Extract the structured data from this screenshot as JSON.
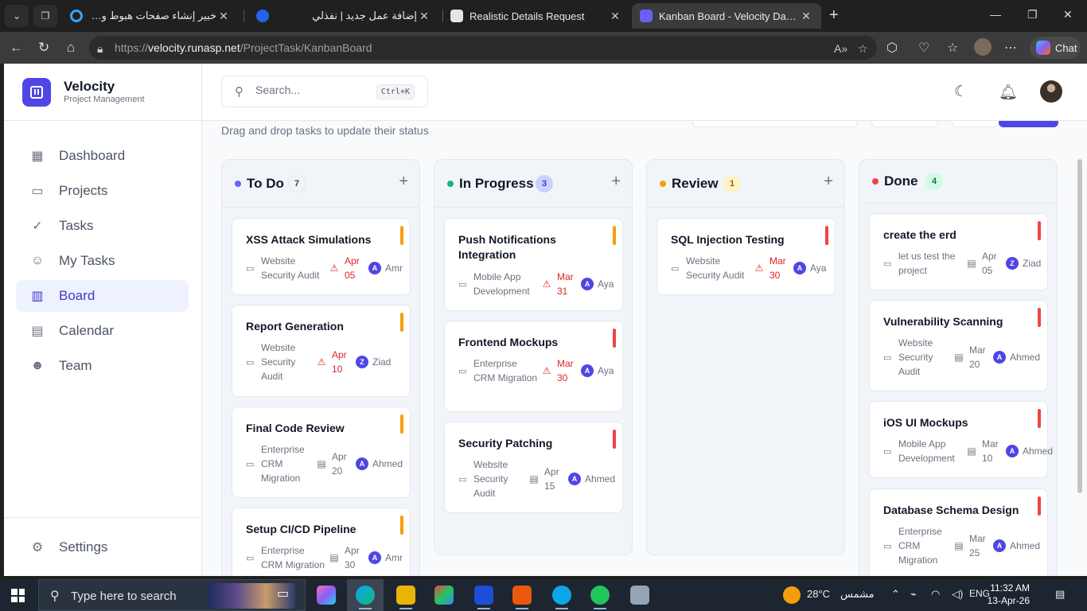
{
  "browser": {
    "tabs": [
      {
        "title": "خبير إنشاء صفحات هبوط ومسارات بي",
        "favicon_color": "#3aa0ff"
      },
      {
        "title": "إضافة عمل جديد | نفذلي",
        "favicon_color": "#2563eb"
      },
      {
        "title": "Realistic Details Request",
        "favicon_color": "#e5e5e5"
      },
      {
        "title": "Kanban Board - Velocity Dashboard",
        "favicon_color": "#6d5ef5"
      }
    ],
    "url_scheme": "https://",
    "url_host": "velocity.runasp.net",
    "url_path": "/ProjectTask/KanbanBoard",
    "chat_label": "Chat"
  },
  "sidebar": {
    "brand_name": "Velocity",
    "brand_sub": "Project Management",
    "items": [
      {
        "label": "Dashboard",
        "icon": "dashboard-icon",
        "glyph": "▦"
      },
      {
        "label": "Projects",
        "icon": "folder-icon",
        "glyph": "▭"
      },
      {
        "label": "Tasks",
        "icon": "check-circle-icon",
        "glyph": "✓"
      },
      {
        "label": "My Tasks",
        "icon": "user-badge-icon",
        "glyph": "☺"
      },
      {
        "label": "Board",
        "icon": "board-icon",
        "glyph": "▥"
      },
      {
        "label": "Calendar",
        "icon": "calendar-icon",
        "glyph": "▤"
      },
      {
        "label": "Team",
        "icon": "team-icon",
        "glyph": "☻"
      }
    ],
    "settings_label": "Settings"
  },
  "topbar": {
    "search_placeholder": "Search...",
    "search_shortcut": "Ctrl+K"
  },
  "board": {
    "subtitle": "Drag and drop tasks to update their status",
    "columns": [
      {
        "title": "To Do",
        "count": "7",
        "dot": "#6366f1",
        "badge_bg": "#f3f4f6",
        "badge_fg": "#374151",
        "cards": [
          {
            "title": "XSS Attack Simulations",
            "project": "Website Security Audit",
            "date": "Apr 05",
            "overdue": true,
            "assignee": "Amr",
            "initial": "A",
            "priority": "#f59e0b"
          },
          {
            "title": "Report Generation",
            "project": "Website Security Audit",
            "date": "Apr 10",
            "overdue": true,
            "assignee": "Ziad",
            "initial": "Z",
            "priority": "#f59e0b"
          },
          {
            "title": "Final Code Review",
            "project": "Enterprise CRM Migration",
            "date": "Apr 20",
            "overdue": false,
            "assignee": "Ahmed",
            "initial": "A",
            "priority": "#f59e0b"
          },
          {
            "title": "Setup CI/CD Pipeline",
            "project": "Enterprise CRM Migration",
            "date": "Apr 30",
            "overdue": false,
            "assignee": "Amr",
            "initial": "A",
            "priority": "#f59e0b"
          }
        ]
      },
      {
        "title": "In Progress",
        "count": "3",
        "dot": "#10b981",
        "badge_bg": "#c7d2fe",
        "badge_fg": "#4338ca",
        "cards": [
          {
            "title": "Push Notifications Integration",
            "project": "Mobile App Development",
            "date": "Mar 31",
            "overdue": true,
            "assignee": "Aya",
            "initial": "A",
            "priority": "#f59e0b"
          },
          {
            "title": "Frontend Mockups",
            "project": "Enterprise CRM Migration",
            "date": "Mar 30",
            "overdue": true,
            "assignee": "Aya",
            "initial": "A",
            "priority": "#ef4444"
          },
          {
            "title": "Security Patching",
            "project": "Website Security Audit",
            "date": "Apr 15",
            "overdue": false,
            "assignee": "Ahmed",
            "initial": "A",
            "priority": "#ef4444"
          }
        ]
      },
      {
        "title": "Review",
        "count": "1",
        "dot": "#f59e0b",
        "badge_bg": "#fef3c7",
        "badge_fg": "#b45309",
        "cards": [
          {
            "title": "SQL Injection Testing",
            "project": "Website Security Audit",
            "date": "Mar 30",
            "overdue": true,
            "assignee": "Aya",
            "initial": "A",
            "priority": "#ef4444"
          }
        ]
      },
      {
        "title": "Done",
        "count": "4",
        "dot": "#ef4444",
        "badge_bg": "#d1fae5",
        "badge_fg": "#047857",
        "cards": [
          {
            "title": "create the erd",
            "project": "let us test the project",
            "date": "Apr 05",
            "overdue": false,
            "assignee": "Ziad",
            "initial": "Z",
            "priority": "#ef4444"
          },
          {
            "title": "Vulnerability Scanning",
            "project": "Website Security Audit",
            "date": "Mar 20",
            "overdue": false,
            "assignee": "Ahmed",
            "initial": "A",
            "priority": "#ef4444"
          },
          {
            "title": "iOS UI Mockups",
            "project": "Mobile App Development",
            "date": "Mar 10",
            "overdue": false,
            "assignee": "Ahmed",
            "initial": "A",
            "priority": "#ef4444"
          },
          {
            "title": "Database Schema Design",
            "project": "Enterprise CRM Migration",
            "date": "Mar 25",
            "overdue": false,
            "assignee": "Ahmed",
            "initial": "A",
            "priority": "#ef4444"
          }
        ]
      }
    ]
  },
  "taskbar": {
    "search_text": "Type here to search",
    "temperature": "28°C",
    "weather": "مشمس",
    "language": "ENG",
    "time": "11:32 AM",
    "date": "13-Apr-26"
  }
}
